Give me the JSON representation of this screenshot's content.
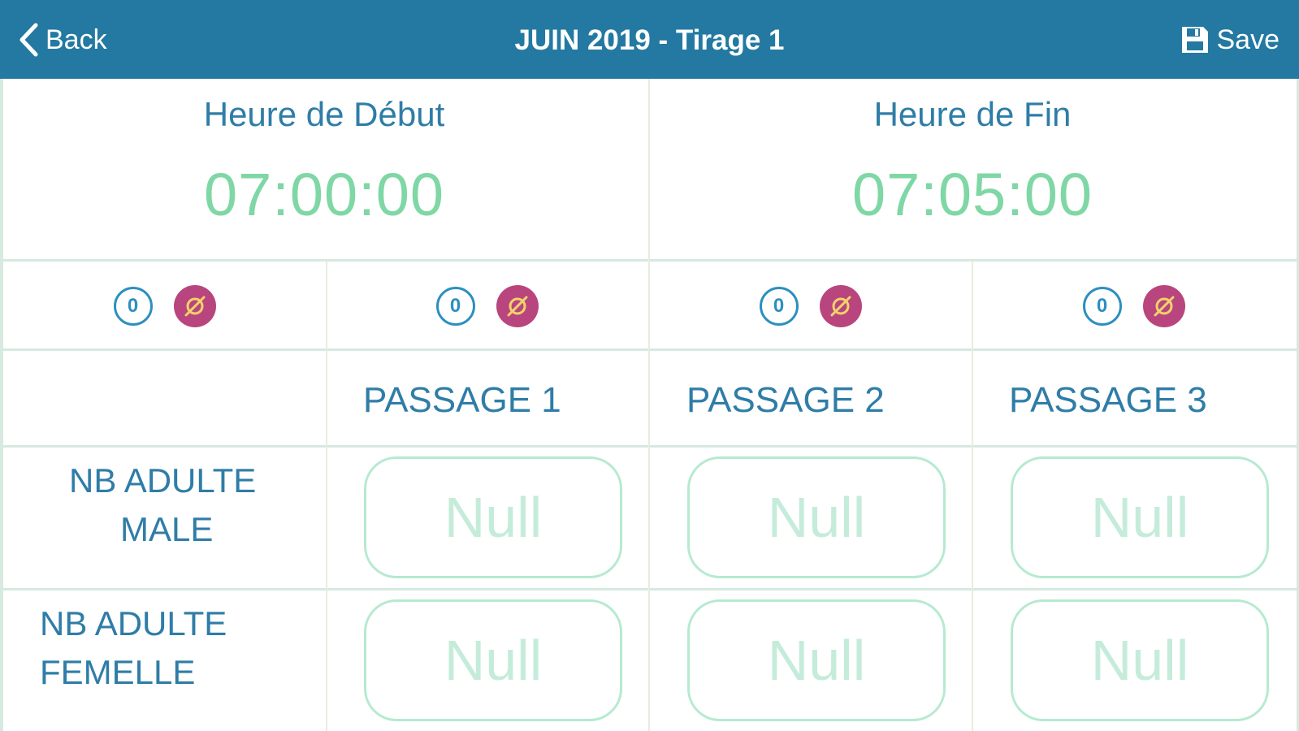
{
  "nav": {
    "back_label": "Back",
    "title": "JUIN 2019 - Tirage 1",
    "save_label": "Save"
  },
  "times": {
    "start_label": "Heure de Début",
    "start_value": "07:00:00",
    "end_label": "Heure de Fin",
    "end_value": "07:05:00"
  },
  "icons": {
    "zero_label": "0"
  },
  "passages": [
    "PASSAGE 1",
    "PASSAGE 2",
    "PASSAGE 3"
  ],
  "rows": [
    {
      "label_line1": "NB ADULTE",
      "label_line2": "MALE",
      "values": [
        "Null",
        "Null",
        "Null"
      ]
    },
    {
      "label_line1": "NB ADULTE",
      "label_line2": "FEMELLE",
      "values": [
        "Null",
        "Null",
        "Null"
      ]
    }
  ],
  "colors": {
    "navbar": "#2379a1",
    "label_blue": "#2f7da7",
    "time_green": "#7fd7a5",
    "null_icon_magenta": "#b9457e",
    "field_border": "#b6ead0"
  }
}
